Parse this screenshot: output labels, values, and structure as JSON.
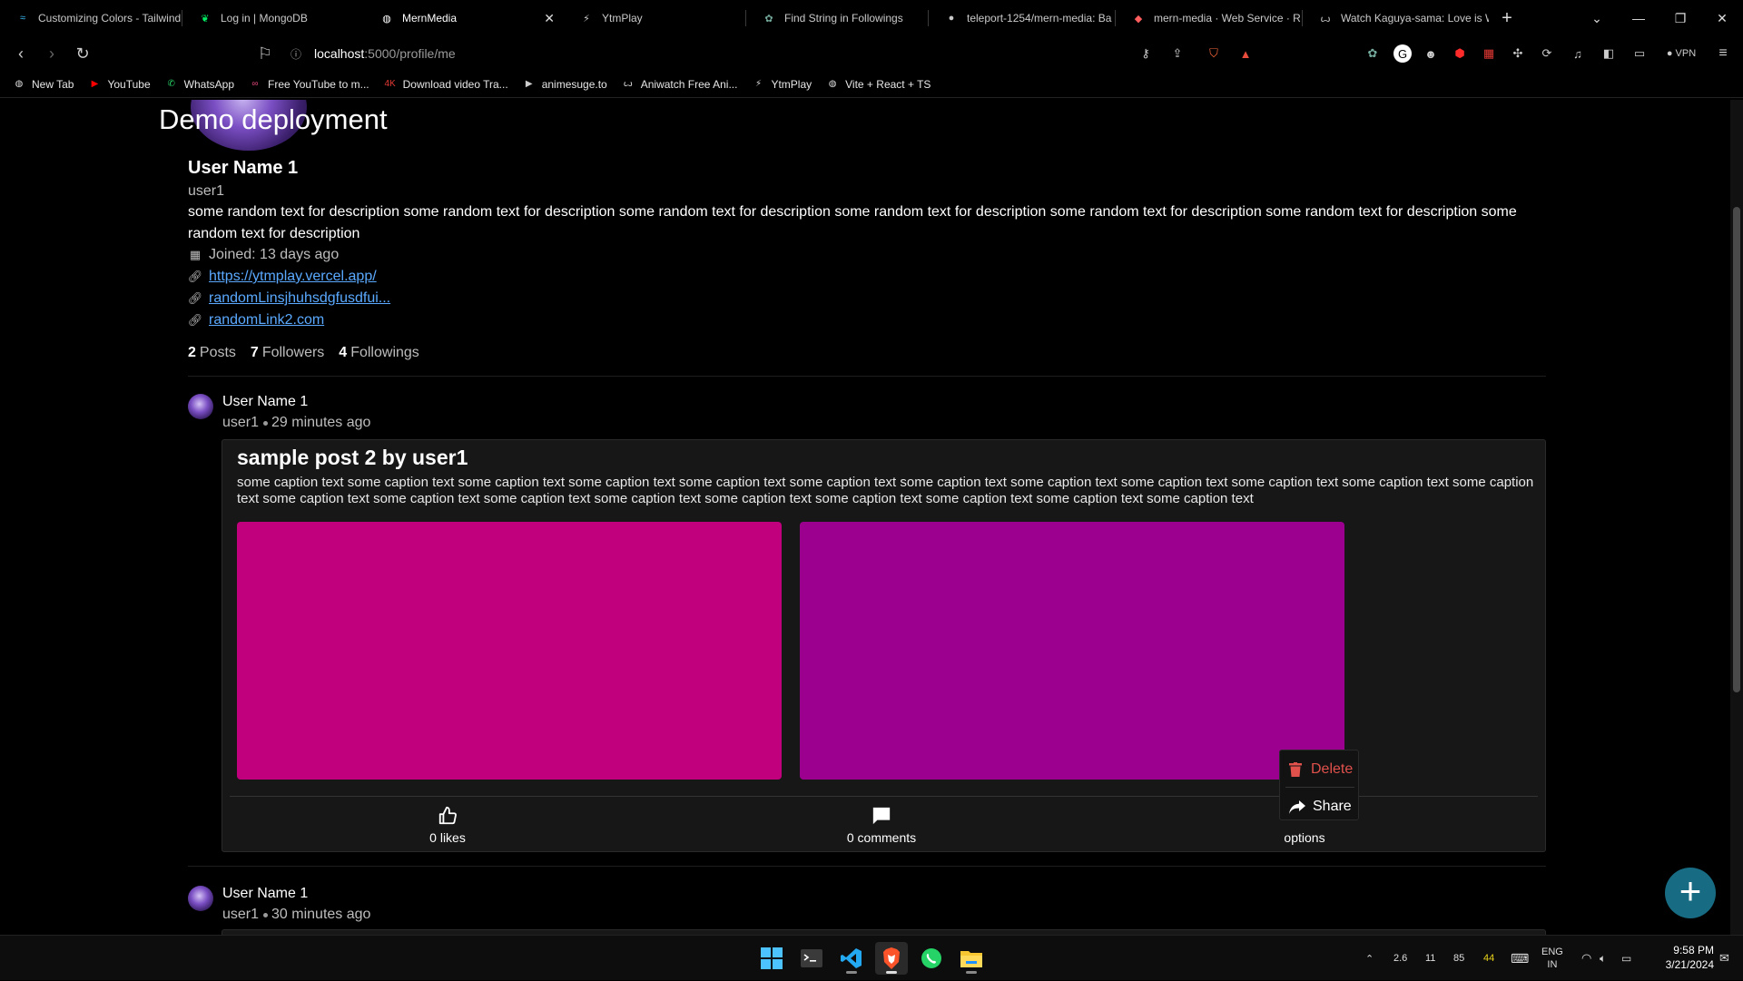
{
  "browser": {
    "tabs": [
      {
        "title": "Customizing Colors - Tailwind",
        "icon": "tailwind-icon",
        "color": "#38bdf8",
        "active": false
      },
      {
        "title": "Log in | MongoDB",
        "icon": "mongodb-icon",
        "color": "#00ed64",
        "active": false
      },
      {
        "title": "MernMedia",
        "icon": "globe-icon",
        "color": "#cccccc",
        "active": true
      },
      {
        "title": "YtmPlay",
        "icon": "ytmplay-icon",
        "color": "#cccccc",
        "active": false
      },
      {
        "title": "Find String in Followings",
        "icon": "chatgpt-icon",
        "color": "#74aa9c",
        "active": false
      },
      {
        "title": "teleport-1254/mern-media: Ba",
        "icon": "github-icon",
        "color": "#ffffff",
        "active": false
      },
      {
        "title": "mern-media · Web Service · R",
        "icon": "render-icon",
        "color": "#ff5e5e",
        "active": false
      },
      {
        "title": "Watch Kaguya-sama: Love is W",
        "icon": "aniwatch-icon",
        "color": "#dddddd",
        "active": false
      }
    ],
    "address": {
      "host": "localhost",
      "path": ":5000/profile/me"
    },
    "vpn_label": "VPN",
    "bookmarks": [
      {
        "label": "New Tab",
        "icon": "globe-icon",
        "color": "#dddddd"
      },
      {
        "label": "YouTube",
        "icon": "youtube-icon",
        "color": "#ff0000"
      },
      {
        "label": "WhatsApp",
        "icon": "whatsapp-icon",
        "color": "#25d366"
      },
      {
        "label": "Free YouTube to m...",
        "icon": "link-icon",
        "color": "#e0457b"
      },
      {
        "label": "Download video Tra...",
        "icon": "4k-icon",
        "color": "#e53935"
      },
      {
        "label": "animesuge.to",
        "icon": "play-icon",
        "color": "#cccccc"
      },
      {
        "label": "Aniwatch Free Ani...",
        "icon": "aniwatch-icon",
        "color": "#dddddd"
      },
      {
        "label": "YtmPlay",
        "icon": "ytmplay-icon",
        "color": "#dddddd"
      },
      {
        "label": "Vite + React + TS",
        "icon": "globe-icon",
        "color": "#dddddd"
      }
    ]
  },
  "page": {
    "banner_text": "Demo deployment",
    "profile": {
      "name": "User Name 1",
      "username": "user1",
      "description": "some random text for description some random text for description some random text for description some random text for description some random text for description some random text for description some random text for description",
      "joined": "Joined: 13 days ago",
      "links": [
        "https://ytmplay.vercel.app/",
        "randomLinsjhuhsdgfusdfui...",
        "randomLink2.com"
      ],
      "stats": {
        "posts_count": "2",
        "posts_label": "Posts",
        "followers_count": "7",
        "followers_label": "Followers",
        "followings_count": "4",
        "followings_label": "Followings"
      }
    },
    "posts": [
      {
        "author": "User Name 1",
        "username": "user1",
        "time": "29 minutes ago",
        "title": "sample post 2 by user1",
        "caption": "some caption text some caption text some caption text some caption text some caption text some caption text some caption text some caption text some caption text some caption text some caption text some caption text some caption text some caption text some caption text some caption text some caption text some caption text some caption text some caption text some caption text",
        "images": [
          {
            "color": "#c0007c"
          },
          {
            "color": "#9c008f"
          }
        ],
        "likes": "0 likes",
        "comments": "0 comments",
        "options": "options",
        "menu": {
          "delete": "Delete",
          "share": "Share"
        }
      },
      {
        "author": "User Name 1",
        "username": "user1",
        "time": "30 minutes ago"
      }
    ],
    "fab_icon": "plus-icon",
    "colors": {
      "accent": "#176c83",
      "link": "#5aa9ff",
      "danger": "#e0514c"
    }
  },
  "taskbar": {
    "apps": [
      "windows-start-icon",
      "terminal-icon",
      "vscode-icon",
      "brave-icon",
      "whatsapp-icon",
      "file-explorer-icon"
    ],
    "tray": {
      "values": [
        "2.6",
        "11",
        "85",
        "44"
      ],
      "lang_top": "ENG",
      "lang_bottom": "IN",
      "time": "9:58 PM",
      "date": "3/21/2024"
    }
  }
}
